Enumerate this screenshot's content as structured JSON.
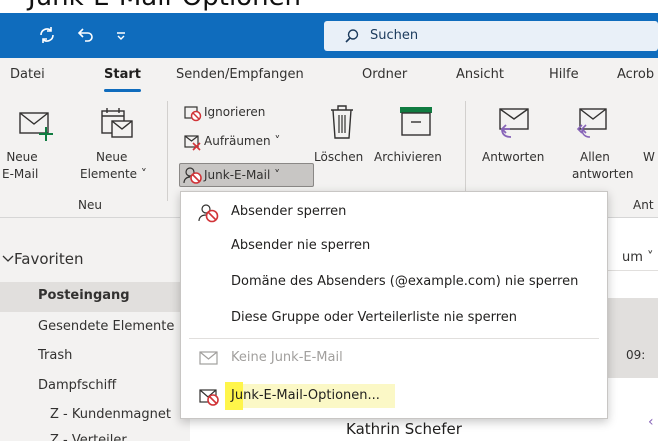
{
  "caption": {
    "text": "Junk-E-Mail-Optionen"
  },
  "titlebar": {
    "search_label": "Suchen"
  },
  "tabs": [
    {
      "label": "Datei"
    },
    {
      "label": "Start"
    },
    {
      "label": "Senden/Empfangen"
    },
    {
      "label": "Ordner"
    },
    {
      "label": "Ansicht"
    },
    {
      "label": "Hilfe"
    },
    {
      "label": "Acrob"
    }
  ],
  "ribbon": {
    "new_mail": [
      "Neue",
      "E-Mail"
    ],
    "new_items": [
      "Neue",
      "Elemente ˅"
    ],
    "group_new": "Neu",
    "ignore": "Ignorieren",
    "cleanup": "Aufräumen ˅",
    "junk": "Junk-E-Mail ˅",
    "delete": "Löschen",
    "archive": "Archivieren",
    "reply": "Antworten",
    "reply_all": [
      "Allen",
      "antworten"
    ],
    "forward_partial": "W",
    "group_respond_partial": "Ant"
  },
  "pane": {
    "favorites": "Favoriten",
    "items": [
      "Posteingang",
      "Gesendete Elemente",
      "Trash",
      "Dampfschiff",
      "Z - Kundenmagnet",
      "Z - Verteiler"
    ]
  },
  "list": {
    "sort_partial": "um ˅",
    "time_partial": "09:",
    "sender": "Kathrin Schefer"
  },
  "dropdown": {
    "items": [
      {
        "label": "Absender sperren"
      },
      {
        "label": "Absender nie sperren"
      },
      {
        "label": "Domäne des Absenders (@example.com) nie sperren"
      },
      {
        "label": "Diese Gruppe oder Verteilerliste nie sperren"
      },
      {
        "label": "Keine Junk-E-Mail"
      },
      {
        "label": "Junk-E-Mail-Optionen..."
      }
    ]
  },
  "colors": {
    "accent": "#0f6cbd",
    "highlight": "#fff54a",
    "block_red": "#d13438"
  }
}
